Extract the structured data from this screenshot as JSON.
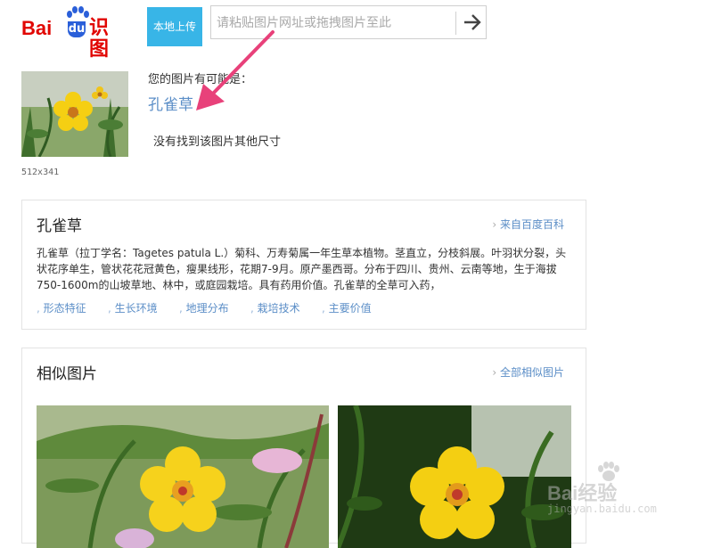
{
  "header": {
    "logo_text_bai": "Bai",
    "logo_text_du": "du",
    "logo_text_shitu": "识图",
    "upload_button": "本地上传",
    "search_placeholder": "请粘贴图片网址或拖拽图片至此"
  },
  "result": {
    "image_size": "512x341",
    "maybe_label": "您的图片有可能是：",
    "result_name": "孔雀草",
    "no_other_sizes": "没有找到该图片其他尺寸"
  },
  "baike": {
    "title": "孔雀草",
    "source_link": "来自百度百科",
    "description": "孔雀草（拉丁学名：Tagetes patula L.）菊科、万寿菊属一年生草本植物。茎直立，分枝斜展。叶羽状分裂，头状花序单生，管状花花冠黄色，瘦果线形，花期7-9月。原产墨西哥。分布于四川、贵州、云南等地，生于海拔750-1600m的山坡草地、林中，或庭园栽培。具有药用价值。孔雀草的全草可入药，",
    "tags": [
      "形态特征",
      "生长环境",
      "地理分布",
      "栽培技术",
      "主要价值"
    ]
  },
  "similar": {
    "title": "相似图片",
    "more_link": "全部相似图片"
  },
  "watermark": {
    "brand": "Bai经验",
    "url": "jingyan.baidu.com"
  },
  "colors": {
    "brand_red": "#e10602",
    "brand_blue": "#2a5fd9",
    "upload_button": "#38b5e7",
    "link": "#5b8ec7",
    "annotation_arrow": "#e8417a"
  },
  "icons": {
    "search_submit": "arrow-right-icon",
    "logo_mark": "paw-icon",
    "annotation": "pointer-arrow-icon"
  }
}
